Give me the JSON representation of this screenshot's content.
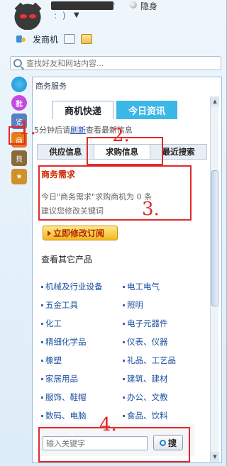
{
  "header": {
    "status": "隐身",
    "mood": ": )",
    "sms_label": "发商机"
  },
  "search": {
    "placeholder": "查找好友和网站内容..."
  },
  "panel": {
    "title": "商务服务",
    "tab_main": "商机快递",
    "tab_news": "今日资讯",
    "refresh_prefix": "5分钟后请",
    "refresh_link": "刷新",
    "refresh_suffix": "查看最新信息",
    "subtabs": [
      "供应信息",
      "求购信息",
      "最近搜索"
    ],
    "demand_title": "商务需求",
    "demand_line1": "今日\"商务需求\"求购商机为 0 条",
    "demand_line2": "建议您修改关键词",
    "modify_button": "立即修改订阅",
    "other_title": "查看其它产品",
    "categories": [
      [
        "机械及行业设备",
        "电工电气"
      ],
      [
        "五金工具",
        "照明"
      ],
      [
        "化工",
        "电子元器件"
      ],
      [
        "精细化学品",
        "仪表、仪器"
      ],
      [
        "橡塑",
        "礼品、工艺品"
      ],
      [
        "家居用品",
        "建筑、建材"
      ],
      [
        "服饰、鞋帽",
        "办公、文教"
      ],
      [
        "数码、电脑",
        "食品、饮料"
      ]
    ],
    "keyword_placeholder": "输入关键字",
    "search_button": "搜"
  },
  "annotations": [
    "1.",
    "2.",
    "3.",
    "4."
  ],
  "colors": {
    "accent": "#3bb7e8",
    "annotation": "#e02a2a",
    "link": "#1a4fa0"
  }
}
